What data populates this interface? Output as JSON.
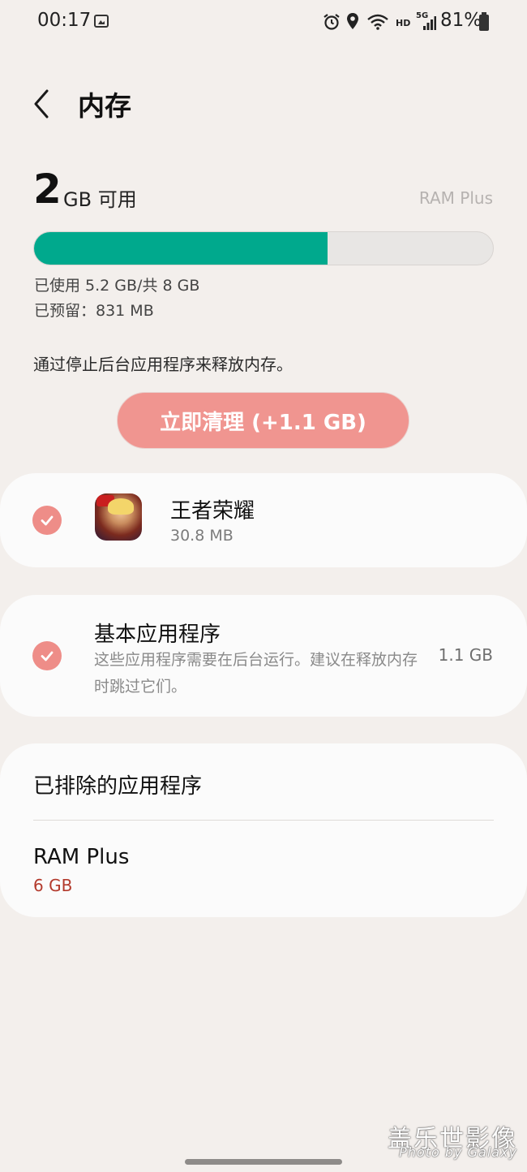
{
  "status_bar": {
    "time": "00:17",
    "network": "5G",
    "hd_label": "HD",
    "battery": "81%"
  },
  "header": {
    "title": "内存"
  },
  "summary": {
    "available_num": "2",
    "available_unit": "GB 可用",
    "ram_plus_link": "RAM Plus",
    "usage_fraction": 0.64,
    "used_text": "已使用 5.2 GB/共 8 GB",
    "reserved_text": "已预留：831 MB",
    "description": "通过停止后台应用程序来释放内存。",
    "clean_button": "立即清理 (+1.1 GB)"
  },
  "apps": [
    {
      "name": "王者荣耀",
      "size": "30.8 MB",
      "checked": true
    }
  ],
  "basic_apps": {
    "title": "基本应用程序",
    "description": "这些应用程序需要在后台运行。建议在释放内存时跳过它们。",
    "size": "1.1 GB",
    "checked": true
  },
  "excluded": {
    "label": "已排除的应用程序"
  },
  "ram_plus": {
    "title": "RAM Plus",
    "value": "6 GB"
  },
  "colors": {
    "accent_green": "#00a98d",
    "button_bg": "#f09590",
    "check_bg": "#ee8d88",
    "ram_plus_value": "#b33a2c"
  },
  "watermark": {
    "line1": "盖乐世影像",
    "line2": "Photo by Galaxy"
  }
}
